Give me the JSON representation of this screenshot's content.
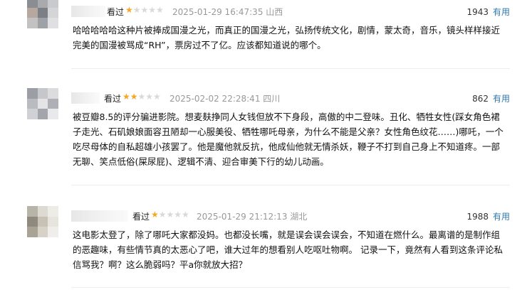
{
  "reviews": [
    {
      "watched_label": "看过",
      "rating": 1,
      "time": "2025-01-29 16:47:35",
      "location": "山西",
      "votes": "1943",
      "useful_label": "有用",
      "content": "哈哈哈哈哈这种片被捧成国漫之光，而真正的国漫之光，弘扬传统文化，剧情，蒙太奇，音乐，镜头样样接近完美的国漫被骂成“RH”，票房过不了亿。应该都知道说的哪个。"
    },
    {
      "watched_label": "看过",
      "rating": 2,
      "time": "2025-02-02 22:28:41",
      "location": "四川",
      "votes": "862",
      "useful_label": "有用",
      "content": "被豆瓣8.5的评分骗进影院。想麦麸挣同人女钱但放不下身段，高傲的中二登味。丑化、牺牲女性(踩女角色裙子走光、石矶娘娘面容丑陋却一心服美役、牺牲哪吒母亲，为什么不能是父亲？女性角色纹花……)哪吒，一个吃尽母体的自私超雄小孩罢了。他是魔他就反抗，他成仙他就无情杀妖，鞭子不打到自己身上不知道疼。一部无聊、笑点低俗(屎尿屁)、逻辑不清、迎合审美下行的幼儿动画。"
    },
    {
      "watched_label": "看过",
      "rating": 1,
      "time": "2025-01-29 21:12:13",
      "location": "湖北",
      "votes": "1988",
      "useful_label": "有用",
      "content": "这电影太登了，除了哪吒大家都没妈。也都没长嘴，就是误会误会误会，不知道在燃什么。最离谱的是制作组的恶趣味，有些情节真的太恶心了吧，谁大过年的想看别人吃呕吐物啊。 记录一下，竟然有人看到这条评论私信骂我？啊？这么脆弱吗？平a你就放大招？"
    }
  ]
}
